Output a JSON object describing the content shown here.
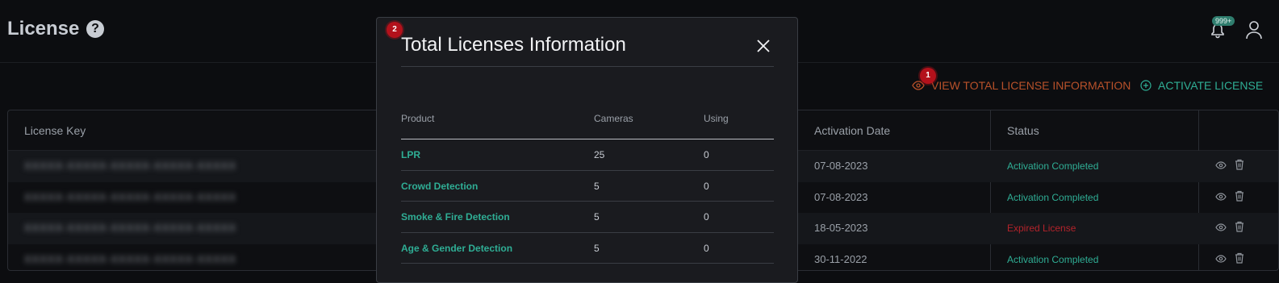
{
  "header": {
    "title": "License",
    "help_icon": "?",
    "notification_count": "999+"
  },
  "actions": {
    "view_total_label": "VIEW TOTAL LICENSE INFORMATION",
    "activate_label": "ACTIVATE LICENSE",
    "step1": "1",
    "step2": "2"
  },
  "table": {
    "columns": [
      "License Key",
      "Activation Date",
      "Status"
    ],
    "rows": [
      {
        "key": "XXXXX-XXXXX-XXXXX-XXXXX-XXXXX",
        "date": "07-08-2023",
        "status": "Activation Completed"
      },
      {
        "key": "XXXXX-XXXXX-XXXXX-XXXXX-XXXXX",
        "date": "07-08-2023",
        "status": "Activation Completed"
      },
      {
        "key": "XXXXX-XXXXX-XXXXX-XXXXX-XXXXX",
        "date": "18-05-2023",
        "status": "Expired License"
      },
      {
        "key": "XXXXX-XXXXX-XXXXX-XXXXX-XXXXX",
        "date": "30-11-2022",
        "status": "Activation Completed"
      }
    ]
  },
  "modal": {
    "title": "Total Licenses Information",
    "columns": {
      "product": "Product",
      "cameras": "Cameras",
      "using": "Using"
    },
    "rows": [
      {
        "product": "LPR",
        "cameras": "25",
        "using": "0"
      },
      {
        "product": "Crowd Detection",
        "cameras": "5",
        "using": "0"
      },
      {
        "product": "Smoke & Fire Detection",
        "cameras": "5",
        "using": "0"
      },
      {
        "product": "Age & Gender Detection",
        "cameras": "5",
        "using": "0"
      }
    ]
  },
  "colors": {
    "accent_teal": "#2fae95",
    "accent_orange": "#b8512a",
    "expired_red": "#b3232b",
    "badge_red": "#b3111b"
  }
}
